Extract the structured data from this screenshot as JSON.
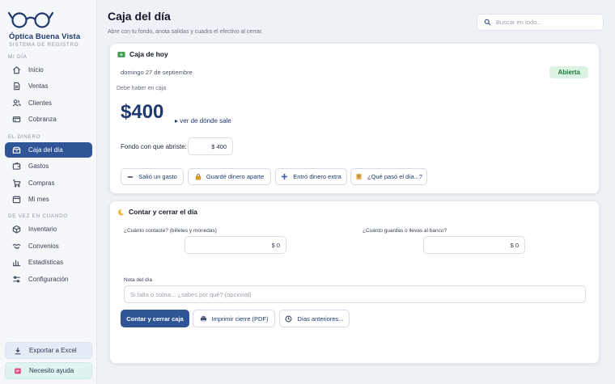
{
  "brand": {
    "name": "Óptica Buena Vista",
    "subtitle": "SISTEMA DE REGISTRO"
  },
  "sidebar": {
    "sections": [
      {
        "title": "MI DÍA",
        "items": [
          {
            "label": "Inicio",
            "icon": "home-icon"
          },
          {
            "label": "Ventas",
            "icon": "receipt-icon"
          },
          {
            "label": "Clientes",
            "icon": "users-icon"
          },
          {
            "label": "Cobranza",
            "icon": "card-icon"
          }
        ]
      },
      {
        "title": "EL DINERO",
        "items": [
          {
            "label": "Caja del día",
            "icon": "cash-box-icon",
            "active": true
          },
          {
            "label": "Gastos",
            "icon": "wallet-icon"
          },
          {
            "label": "Compras",
            "icon": "cart-icon"
          },
          {
            "label": "Mi mes",
            "icon": "calendar-icon"
          }
        ]
      },
      {
        "title": "DE VEZ EN CUANDO",
        "items": [
          {
            "label": "Inventario",
            "icon": "box-icon"
          },
          {
            "label": "Convenios",
            "icon": "handshake-icon"
          },
          {
            "label": "Estadísticas",
            "icon": "bar-chart-icon"
          },
          {
            "label": "Configuración",
            "icon": "sliders-icon"
          }
        ]
      }
    ],
    "export_label": "Exportar a Excel",
    "help_label": "Necesito ayuda"
  },
  "header": {
    "title": "Caja del día",
    "subtitle": "Abre con tu fondo, anota salidas y cuadra el efectivo al cerrar.",
    "search_placeholder": "Buscar en todo..."
  },
  "today": {
    "title": "Caja de hoy",
    "date": "domingo 27 de septiembre",
    "status": "Abierta",
    "must_label": "Debe haber en caja",
    "amount": "$400",
    "see_link": "▸ ver de dónde sale",
    "fund_label": "Fondo con que abriste:",
    "fund_value": "$ 400",
    "actions": {
      "expense": "Salió un gasto",
      "saved": "Guardé dinero aparte",
      "extra": "Entró dinero extra",
      "what": "¿Qué pasó el día...?"
    }
  },
  "close": {
    "title": "Contar y cerrar el día",
    "counted_label": "¿Cuánto contaste? (billetes y monedas)",
    "counted_value": "$ 0",
    "bank_label": "¿Cuánto guardas o llevas al banco?",
    "bank_value": "$ 0",
    "note_label": "Nota del día",
    "note_placeholder": "Si falta o sobra... ¿sabes por qué? (opcional)",
    "close_button": "Contar y cerrar caja",
    "print_button": "Imprimir cierre (PDF)",
    "previous_button": "Días anteriores..."
  },
  "colors": {
    "accent": "#2f5596",
    "brand": "#1e3a6e",
    "open": "#1b7a3e"
  }
}
